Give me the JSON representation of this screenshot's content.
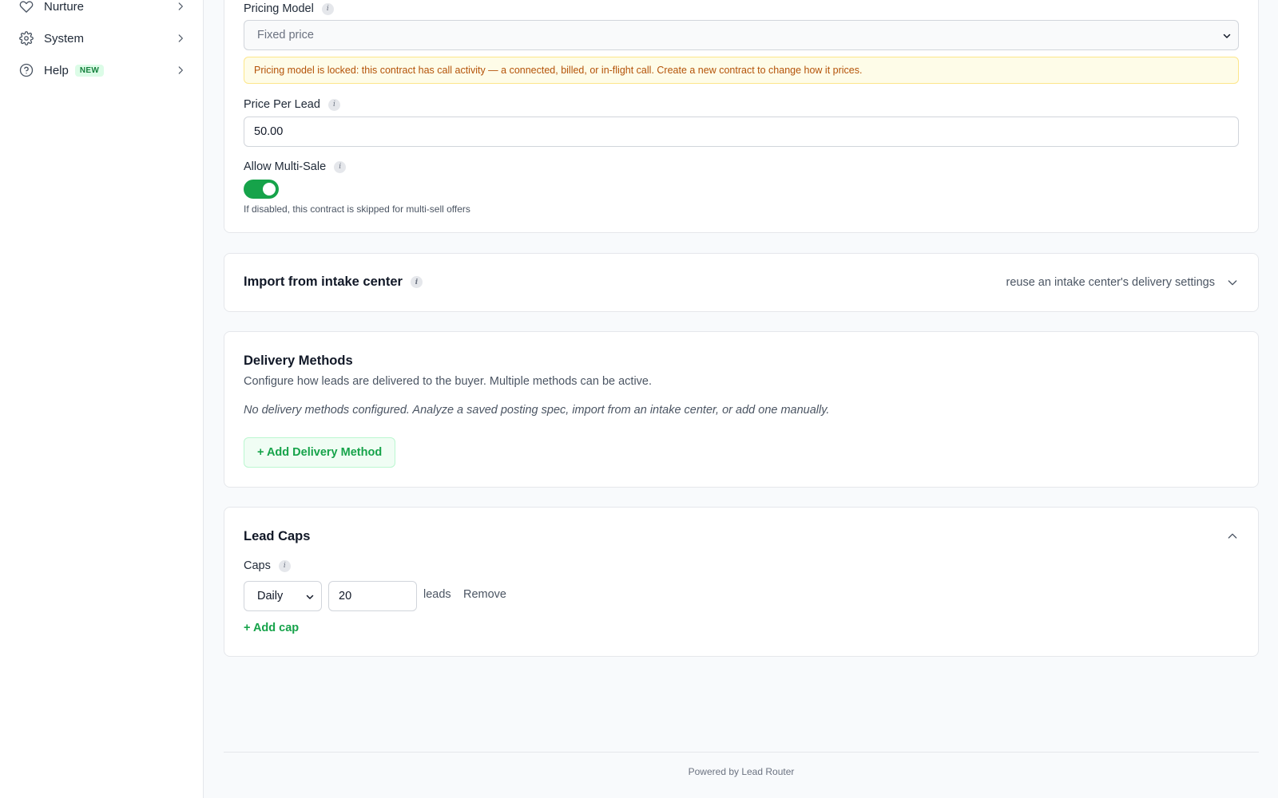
{
  "sidebar": {
    "items": [
      {
        "label": "Nurture",
        "icon": "heart-icon"
      },
      {
        "label": "System",
        "icon": "gear-icon"
      },
      {
        "label": "Help",
        "icon": "help-circle-icon",
        "badge": "NEW"
      }
    ]
  },
  "pricing": {
    "model_label": "Pricing Model",
    "model_value": "Fixed price",
    "lock_notice": "Pricing model is locked: this contract has call activity — a connected, billed, or in-flight call. Create a new contract to change how it prices.",
    "price_label": "Price Per Lead",
    "price_value": "50.00",
    "multisale_label": "Allow Multi-Sale",
    "multisale_enabled": true,
    "multisale_help": "If disabled, this contract is skipped for multi-sell offers"
  },
  "import": {
    "title": "Import from intake center",
    "hint": "reuse an intake center's delivery settings"
  },
  "delivery": {
    "title": "Delivery Methods",
    "description": "Configure how leads are delivered to the buyer. Multiple methods can be active.",
    "empty": "No delivery methods configured. Analyze a saved posting spec, import from an intake center, or add one manually.",
    "add_button": "+ Add Delivery Method"
  },
  "caps": {
    "title": "Lead Caps",
    "label": "Caps",
    "period": "Daily",
    "value": "20",
    "unit": "leads",
    "remove": "Remove",
    "add": "+ Add cap"
  },
  "footer": {
    "text": "Powered by Lead Router"
  },
  "colors": {
    "accent": "#16a34a",
    "warning_bg": "#fefce8",
    "warning_text": "#b45309"
  }
}
